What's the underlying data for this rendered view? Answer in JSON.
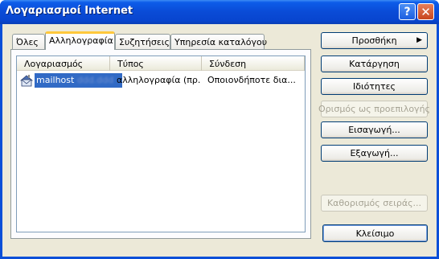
{
  "window": {
    "title": "Λογαριασμοί Internet",
    "help_glyph": "?",
    "close_glyph": "✕"
  },
  "tabs": [
    {
      "label": "Όλες",
      "active": false
    },
    {
      "label": "Αλληλογραφία",
      "active": true
    },
    {
      "label": "Συζητήσεις",
      "active": false
    },
    {
      "label": "Υπηρεσία καταλόγου",
      "active": false
    }
  ],
  "list": {
    "columns": [
      "Λογαριασμός",
      "Τύπος",
      "Σύνδεση"
    ],
    "rows": [
      {
        "account": "mailhost",
        "account_obscured": "ddd.ddd",
        "type": "αλληλογραφία (πρ...",
        "connection": "Οποιονδήποτε δια...",
        "selected": true,
        "icon": "mail-account-icon"
      }
    ]
  },
  "buttons": {
    "add": "Προσθήκη",
    "add_arrow": "▶",
    "remove": "Κατάργηση",
    "properties": "Ιδιότητες",
    "set_default": "Ορισμός ως προεπιλογής",
    "import": "Εισαγωγή...",
    "export": "Εξαγωγή...",
    "set_order": "Καθορισμός σειράς...",
    "close": "Κλείσιμο"
  },
  "colors": {
    "titlebar": "#0a4bd6",
    "dialog_bg": "#ece9d8",
    "selection": "#316ac5",
    "active_tab_accent": "#ffc83c"
  }
}
